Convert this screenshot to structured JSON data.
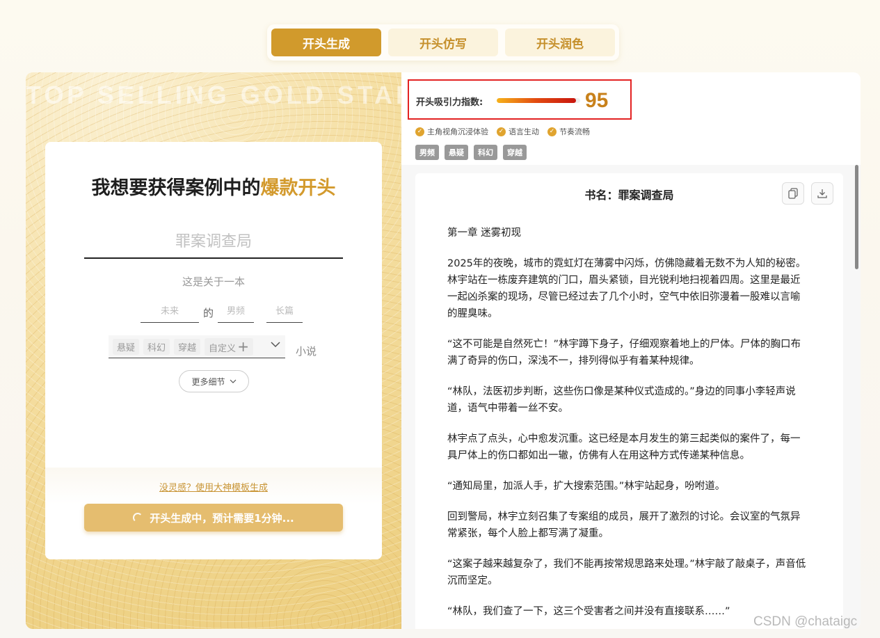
{
  "tabs": [
    {
      "label": "开头生成",
      "active": true
    },
    {
      "label": "开头仿写",
      "active": false
    },
    {
      "label": "开头润色",
      "active": false
    }
  ],
  "left": {
    "watermark": "TOP SELLING GOLD START",
    "title_prefix": "我想要获得案例中的",
    "title_highlight": "爆款开头",
    "book_placeholder": "罪案调查局",
    "about_text": "这是关于一本",
    "setting": "未来",
    "de": "的",
    "audience": "男频",
    "length": "长篇",
    "tags": [
      "悬疑",
      "科幻",
      "穿越"
    ],
    "custom_label": "自定义",
    "novel_label": "小说",
    "more_details": "更多细节",
    "template_link": "没灵感？使用大神模板生成",
    "generating_label": "开头生成中，预计需要1分钟..."
  },
  "right": {
    "score_label": "开头吸引力指数:",
    "score_value": "95",
    "score_fraction": 0.95,
    "features": [
      "主角视角沉浸体验",
      "语言生动",
      "节奏流畅"
    ],
    "genres": [
      "男频",
      "悬疑",
      "科幻",
      "穿越"
    ],
    "book_title": "书名：罪案调查局",
    "paragraphs": [
      "第一章 迷雾初现",
      "2025年的夜晚，城市的霓虹灯在薄雾中闪烁，仿佛隐藏着无数不为人知的秘密。林宇站在一栋废弃建筑的门口，眉头紧锁，目光锐利地扫视着四周。这里是最近一起凶杀案的现场，尽管已经过去了几个小时，空气中依旧弥漫着一股难以言喻的腥臭味。",
      "“这不可能是自然死亡！”林宇蹲下身子，仔细观察着地上的尸体。尸体的胸口布满了奇异的伤口，深浅不一，排列得似乎有着某种规律。",
      "“林队，法医初步判断，这些伤口像是某种仪式造成的。”身边的同事小李轻声说道，语气中带着一丝不安。",
      "林宇点了点头，心中愈发沉重。这已经是本月发生的第三起类似的案件了，每一具尸体上的伤口都如出一辙，仿佛有人在用这种方式传递某种信息。",
      "“通知局里，加派人手，扩大搜索范围。”林宇站起身，吩咐道。",
      "回到警局，林宇立刻召集了专案组的成员，展开了激烈的讨论。会议室的气氛异常紧张，每个人脸上都写满了凝重。",
      "“这案子越来越复杂了，我们不能再按常规思路来处理。”林宇敲了敲桌子，声音低沉而坚定。",
      "“林队，我们查了一下，这三个受害者之间并没有直接联系……”"
    ]
  },
  "watermark_credit": "CSDN @chataigc"
}
